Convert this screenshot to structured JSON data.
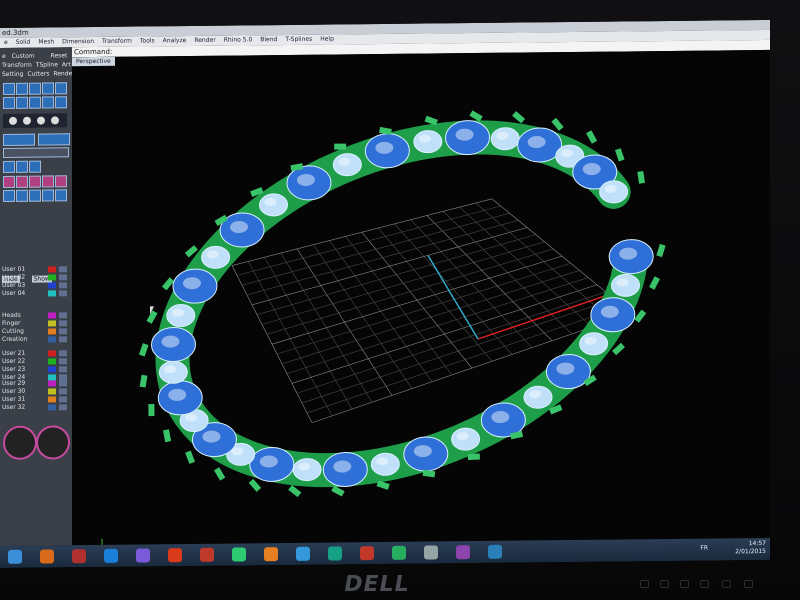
{
  "window": {
    "title": "ed.3dm"
  },
  "menu": [
    "e",
    "Solid",
    "Mesh",
    "Dimension",
    "Transform",
    "Tools",
    "Analyze",
    "Render",
    "Rhino 5.0",
    "Blend",
    "T-Splines",
    "Help"
  ],
  "left_panel": {
    "tabs": [
      "e",
      "Custom",
      "Reset"
    ],
    "tool_tabs": [
      "Transform",
      "TSpline",
      "Art"
    ],
    "tool_tabs2": [
      "Setting",
      "Cutters",
      "Render"
    ],
    "layer_header": [
      "Hide",
      "Show"
    ],
    "layers_a": [
      "User 01",
      "User 02",
      "User 03",
      "User 04"
    ],
    "layers_b": [
      "Heads",
      "Finger",
      "Cutting",
      "Creation"
    ],
    "layers_c": [
      "User 21",
      "User 22",
      "User 23",
      "User 24"
    ],
    "layers_d": [
      "User 29",
      "User 30",
      "User 31",
      "User 32"
    ],
    "layer_colors": [
      "#d02020",
      "#20b020",
      "#2040d0",
      "#20c0c0",
      "#c020c0",
      "#c0c020",
      "#e08020",
      "#3060a0"
    ]
  },
  "command": {
    "label": "Command:"
  },
  "viewport": {
    "tab": "Perspective"
  },
  "taskbar": {
    "lang": "FR",
    "time": "14:57",
    "date": "2/01/2015",
    "icon_colors": [
      "#3a8fd8",
      "#d86a1a",
      "#b03030",
      "#1a7fd8",
      "#7a5ad8",
      "#d83a1a",
      "#c0392b",
      "#2ecc71",
      "#e67e22",
      "#3498db",
      "#16a085",
      "#c0392b",
      "#27ae60",
      "#95a5a6",
      "#8e44ad",
      "#2980b9"
    ]
  },
  "brand": {
    "name": "DELL"
  }
}
